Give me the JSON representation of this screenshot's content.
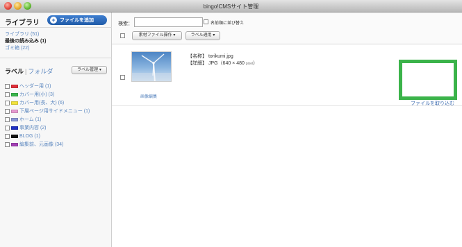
{
  "window": {
    "title": "bingo!CMSサイト管理"
  },
  "sidebar": {
    "library_title": "ライブラリ",
    "add_file_label": "ファイルを追加",
    "library_items": [
      {
        "label": "ライブラリ (51)"
      },
      {
        "label": "最後の読み込み (1)"
      },
      {
        "label": "ゴミ箱 (22)"
      }
    ],
    "label_tab": "ラベル",
    "folder_tab": "フォルダ",
    "label_manage_button": "ラベル管理 ▾",
    "labels": [
      {
        "label": "ヘッダー用 (1)",
        "color": "#e0303a"
      },
      {
        "label": "カバー用(小) (3)",
        "color": "#38b54a"
      },
      {
        "label": "カバー用(長、大) (6)",
        "color": "#f2e23a"
      },
      {
        "label": "下層ページ用サイドメニュー (1)",
        "color": "#e79ad0"
      },
      {
        "label": "ホーム (1)",
        "color": "#8a96d6"
      },
      {
        "label": "事業内容 (2)",
        "color": "#1f2ec4"
      },
      {
        "label": "BLOG (1)",
        "color": "#111111"
      },
      {
        "label": "編集前、元画像 (34)",
        "color": "#a23fb3"
      }
    ]
  },
  "toolbar": {
    "search_label": "検索：",
    "search_value": "",
    "sort_label": "名前順に並び替え",
    "material_ops_button": "素材ファイル操作 ▾",
    "label_apply_button": "ラベル適用 ▾"
  },
  "file": {
    "name_line": "【名称】 torikumi.jpg",
    "detail_prefix": "【詳細】 JPG（640 × 480 ",
    "detail_unit": "pixel",
    "detail_suffix": "）",
    "edit_image_label": "画像編集",
    "import_label": "ファイルを取り込む"
  },
  "colors": {
    "highlight": "#3bb34a",
    "link": "#3c6bb0",
    "button_blue": "#2a65b5"
  }
}
